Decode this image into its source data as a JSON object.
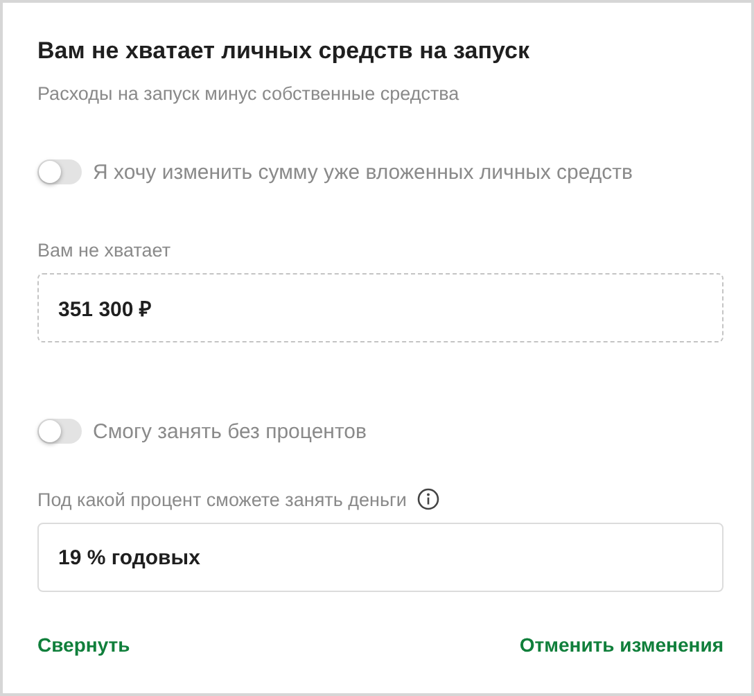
{
  "title": "Вам не хватает личных средств на запуск",
  "subtitle": "Расходы на запуск минус собственные средства",
  "sections": [
    {
      "toggle": {
        "label": "Я хочу изменить сумму уже вложенных личных средств",
        "on": false
      },
      "field": {
        "label": "Вам не хватает",
        "value": "351 300 ₽",
        "readonly": true,
        "info": false
      }
    },
    {
      "toggle": {
        "label": "Смогу занять без процентов",
        "on": false
      },
      "field": {
        "label": "Под какой процент сможете занять деньги",
        "value": "19 % годовых",
        "readonly": false,
        "info": true
      }
    }
  ],
  "actions": [
    {
      "label": "Свернуть"
    },
    {
      "label": "Отменить изменения"
    }
  ]
}
